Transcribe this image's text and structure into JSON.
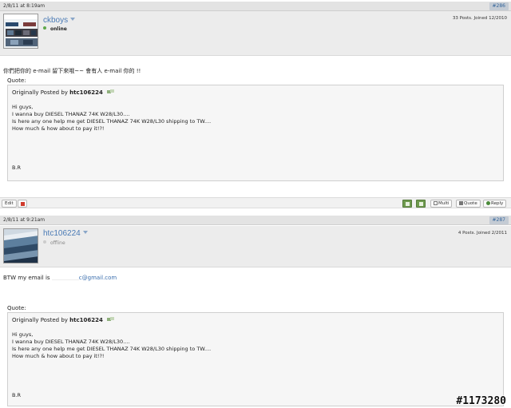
{
  "post1": {
    "date": "2/8/11 at 8:19am",
    "number": "#286",
    "username": "ckboys",
    "status": "online",
    "status_color": "#5fa84a",
    "stats": "33 Posts. Joined 12/2010",
    "message": "你們把你的 e-mail 留下來哦~~ 會有人 e-mail 你的 !!",
    "quote_label": "Quote:",
    "quote_prefix": "Originally Posted by",
    "quote_author": "htc106224",
    "quote_lines": [
      "Hi guys,",
      "I wanna buy DIESEL THANAZ 74K W28/L30....",
      "Is here any one help me get DIESEL THANAZ 74K W28/L30 shipping to TW....",
      "How much & how about to pay it!?!",
      "B.R"
    ],
    "actions": {
      "edit": "Edit",
      "multi": "Multi",
      "quote": "Quote",
      "reply": "Reply"
    }
  },
  "post2": {
    "date": "2/8/11 at 9:21am",
    "number": "#287",
    "username": "htc106224",
    "status": "offline",
    "status_color": "#cccccc",
    "stats": "4 Posts. Joined 2/2011",
    "message_prefix": "BTW my email is",
    "message_email": "c@gmail.com",
    "quote_label": "Quote:",
    "quote_prefix": "Originally Posted by",
    "quote_author": "htc106224",
    "quote_lines": [
      "Hi guys,",
      "I wanna buy DIESEL THANAZ 74K W28/L30....",
      "Is here any one help me get DIESEL THANAZ 74K W28/L30 shipping to TW....",
      "How much & how about to pay it!?!",
      "B.R"
    ]
  },
  "watermark": "#1173280",
  "colors": {
    "link_blue": "#4a7ab5",
    "header_gray": "#e3e3e3",
    "post_number_bg": "#c4cbd4"
  }
}
